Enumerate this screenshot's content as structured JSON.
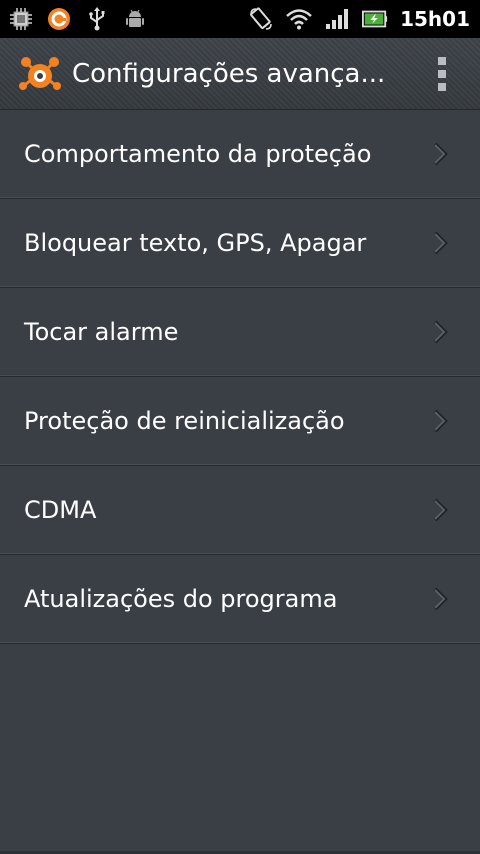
{
  "status_bar": {
    "time": "15h01",
    "left_icons": [
      "cpu-icon",
      "avast-notification-icon",
      "usb-icon",
      "android-debug-icon"
    ],
    "right_icons": [
      "screen-rotate-icon",
      "wifi-icon",
      "signal-icon",
      "battery-charging-icon"
    ]
  },
  "action_bar": {
    "title": "Configurações avança...",
    "logo_icon": "avast-logo-icon",
    "menu_icon": "overflow-menu-icon",
    "accent_color": "#f58220"
  },
  "menu": {
    "items": [
      {
        "label": "Comportamento da proteção"
      },
      {
        "label": "Bloquear texto, GPS, Apagar"
      },
      {
        "label": "Tocar alarme"
      },
      {
        "label": "Proteção de reinicialização"
      },
      {
        "label": "CDMA"
      },
      {
        "label": "Atualizações do programa"
      }
    ]
  }
}
